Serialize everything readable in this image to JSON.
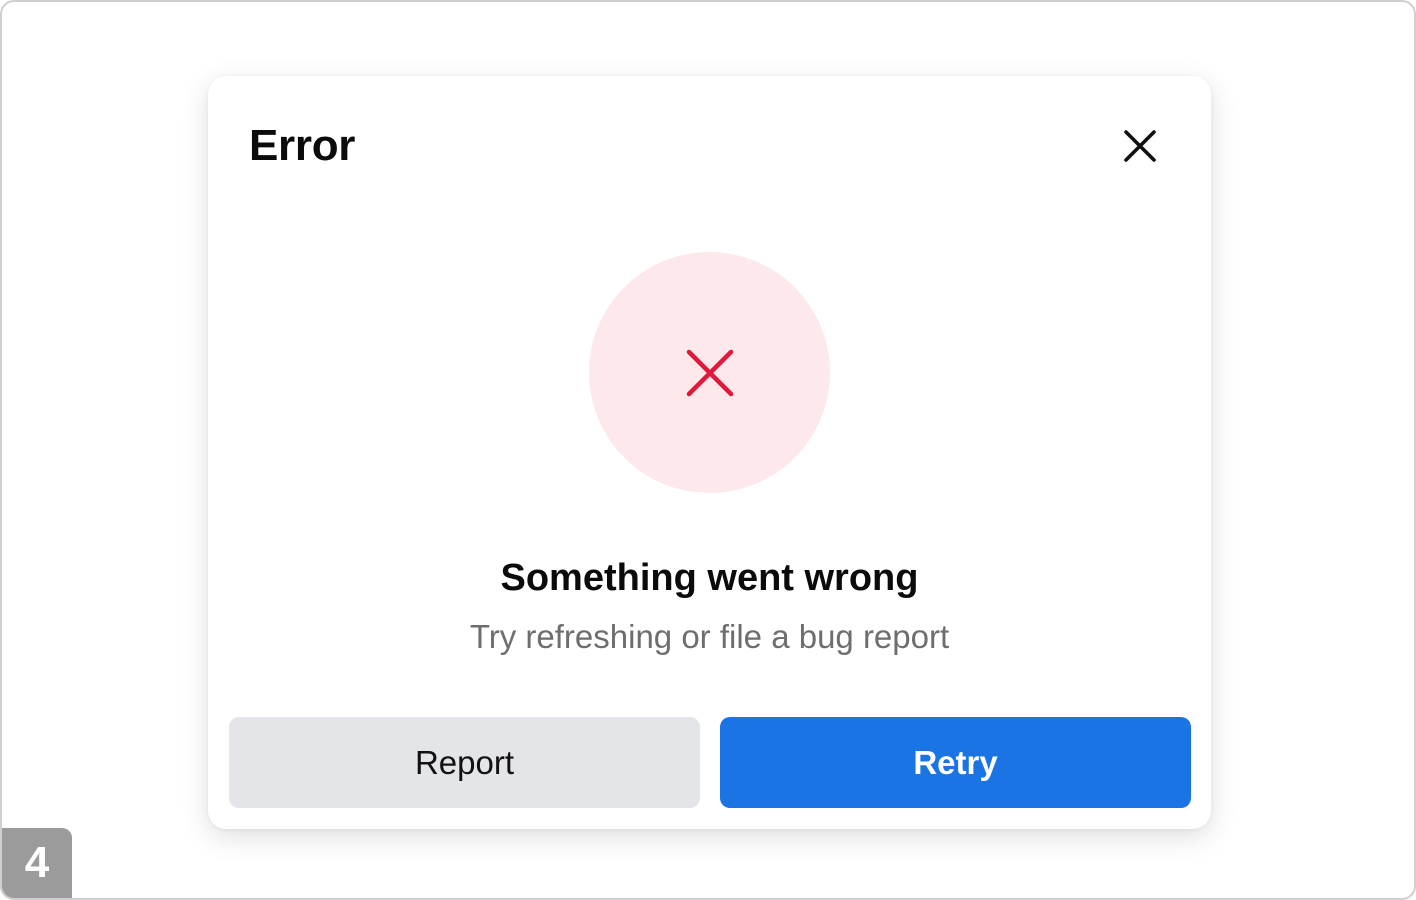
{
  "dialog": {
    "title": "Error",
    "close_icon": "close-icon",
    "status_icon": "error-x-icon",
    "headline": "Something went wrong",
    "message": "Try refreshing or file a bug report",
    "buttons": {
      "report_label": "Report",
      "retry_label": "Retry"
    }
  },
  "step_badge": "4",
  "colors": {
    "primary": "#1b74e4",
    "secondary_button": "#e4e5e9",
    "error": "#e0193a",
    "error_bg": "#fde9ec"
  }
}
